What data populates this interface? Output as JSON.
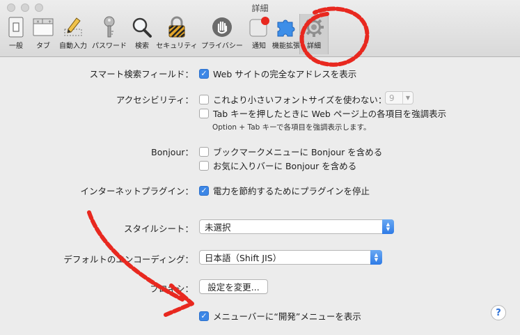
{
  "window": {
    "title": "詳細"
  },
  "toolbar": {
    "items": [
      {
        "label": "一般"
      },
      {
        "label": "タブ"
      },
      {
        "label": "自動入力"
      },
      {
        "label": "パスワード"
      },
      {
        "label": "検索"
      },
      {
        "label": "セキュリティ"
      },
      {
        "label": "プライバシー"
      },
      {
        "label": "通知"
      },
      {
        "label": "機能拡張"
      },
      {
        "label": "詳細"
      }
    ],
    "selected": "詳細"
  },
  "settings": {
    "smart_search": {
      "label": "スマート検索フィールド：",
      "option": "Web サイトの完全なアドレスを表示",
      "checked": true
    },
    "accessibility": {
      "label": "アクセシビリティ：",
      "option1": "これより小さいフォントサイズを使わない：",
      "font_size_value": "9",
      "option2": "Tab キーを押したときに Web ページ上の各項目を強調表示",
      "note": "Option + Tab キーで各項目を強調表示します。"
    },
    "bonjour": {
      "label": "Bonjour：",
      "option1": "ブックマークメニューに Bonjour を含める",
      "option2": "お気に入りバーに Bonjour を含める"
    },
    "plugins": {
      "label": "インターネットプラグイン：",
      "option": "電力を節約するためにプラグインを停止",
      "checked": true
    },
    "stylesheet": {
      "label": "スタイルシート：",
      "value": "未選択"
    },
    "encoding": {
      "label": "デフォルトのエンコーディング：",
      "value": "日本語（Shift JIS）"
    },
    "proxy": {
      "label": "プロキシ：",
      "button": "設定を変更..."
    },
    "develop_menu": {
      "option": "メニューバーに“開発”メニューを表示",
      "checked": true
    }
  },
  "help": {
    "symbol": "?"
  },
  "colors": {
    "accent": "#3d87e6",
    "annotation": "#e8281f"
  }
}
